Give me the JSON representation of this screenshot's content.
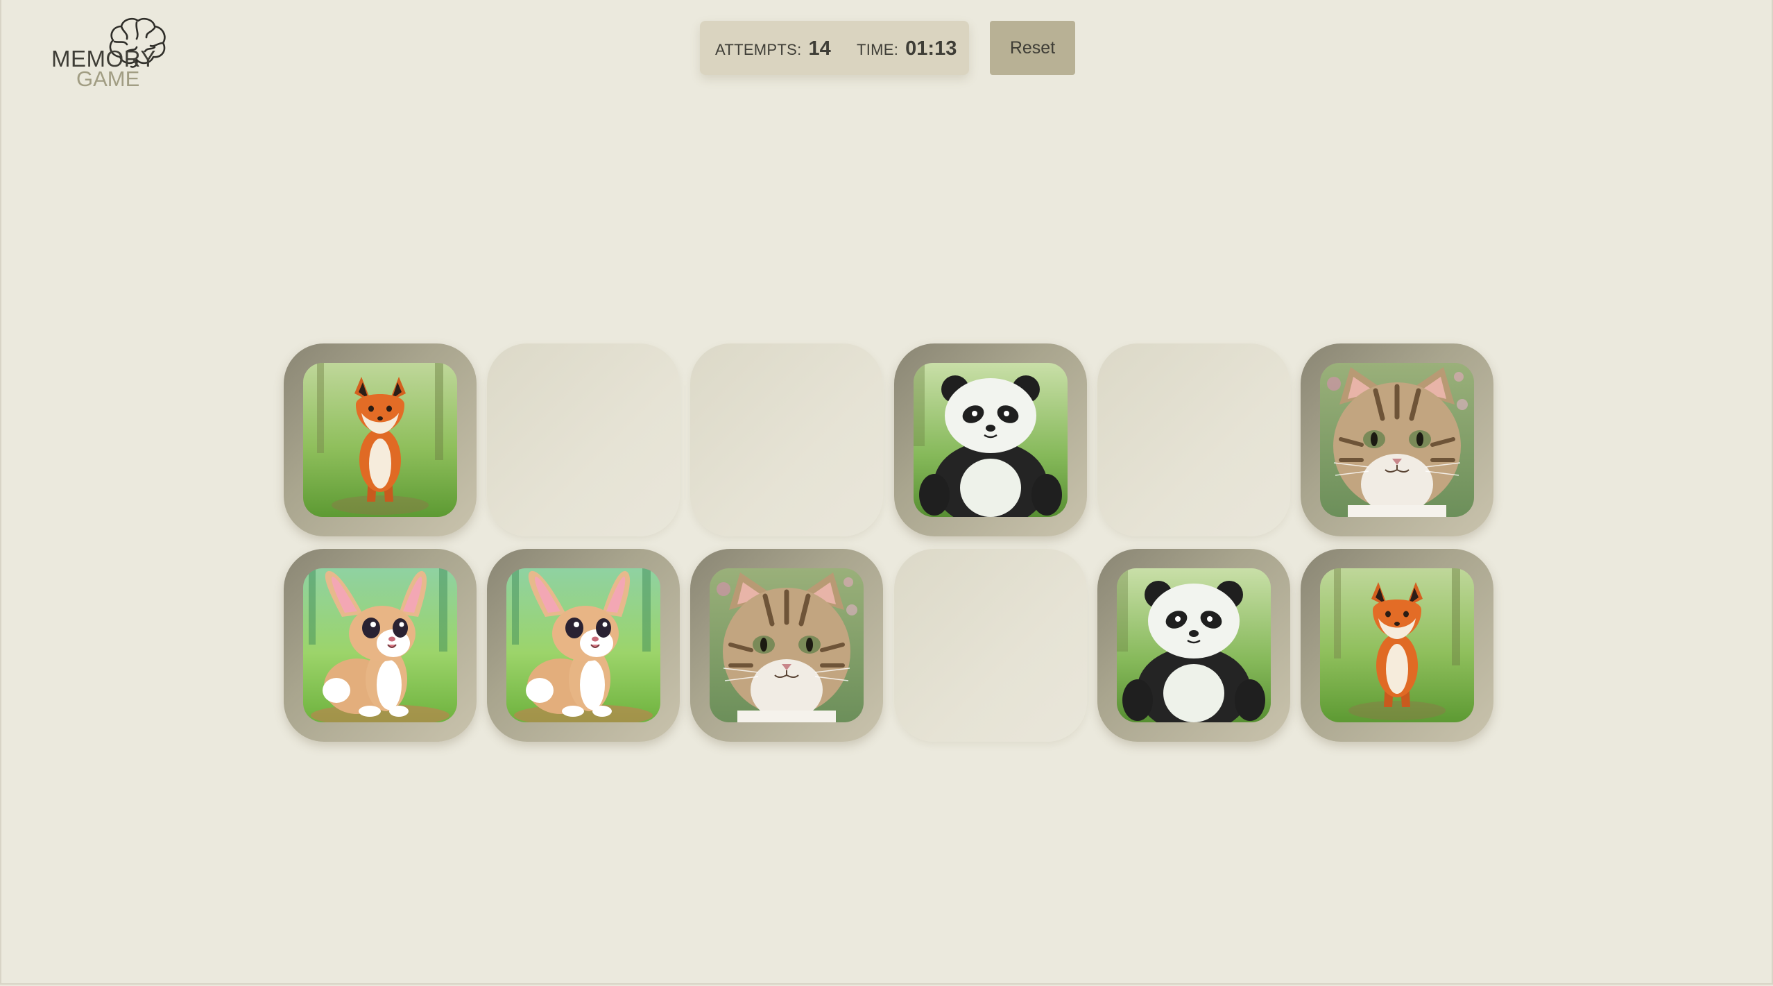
{
  "app": {
    "logo_word": "MEMORY",
    "logo_sub": "GAME"
  },
  "stats": {
    "attempts_label": "ATTEMPTS:",
    "attempts_value": "14",
    "time_label": "TIME:",
    "time_value": "01:13"
  },
  "controls": {
    "reset_label": "Reset"
  },
  "board": {
    "rows": 2,
    "cols": 6,
    "cards": [
      {
        "row": 1,
        "col": 1,
        "state": "face-up",
        "animal": "fox"
      },
      {
        "row": 1,
        "col": 2,
        "state": "face-down",
        "animal": ""
      },
      {
        "row": 1,
        "col": 3,
        "state": "face-down",
        "animal": ""
      },
      {
        "row": 1,
        "col": 4,
        "state": "face-up",
        "animal": "panda"
      },
      {
        "row": 1,
        "col": 5,
        "state": "face-down",
        "animal": ""
      },
      {
        "row": 1,
        "col": 6,
        "state": "face-up",
        "animal": "cat"
      },
      {
        "row": 2,
        "col": 1,
        "state": "face-up",
        "animal": "rabbit"
      },
      {
        "row": 2,
        "col": 2,
        "state": "face-up",
        "animal": "rabbit"
      },
      {
        "row": 2,
        "col": 3,
        "state": "face-up",
        "animal": "cat"
      },
      {
        "row": 2,
        "col": 4,
        "state": "face-down",
        "animal": ""
      },
      {
        "row": 2,
        "col": 5,
        "state": "face-up",
        "animal": "panda"
      },
      {
        "row": 2,
        "col": 6,
        "state": "face-up",
        "animal": "fox"
      }
    ]
  },
  "colors": {
    "background": "#ebe9dd",
    "panel": "#dad4c0",
    "button": "#b8b195",
    "text": "#3e3d36",
    "logo_accent": "#a19d83"
  }
}
